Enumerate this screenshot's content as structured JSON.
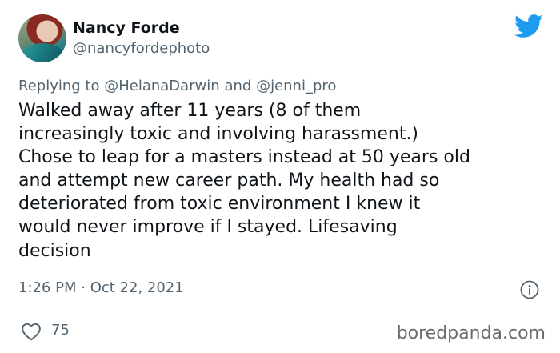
{
  "author": {
    "name": "Nancy Forde",
    "handle": "@nancyfordephoto"
  },
  "reply": {
    "prefix": "Replying to",
    "mention1": "@HelanaDarwin",
    "conjunction": "and",
    "mention2": "@jenni_pro"
  },
  "tweet": {
    "lines": [
      "Walked away after 11 years (8 of them",
      "increasingly toxic and involving harassment.)",
      "Chose to leap for a masters instead at 50 years old",
      "and attempt new career path. My health had so",
      "deteriorated from toxic environment I knew it",
      "would never improve if I stayed. Lifesaving",
      "decision"
    ],
    "timestamp": "1:26 PM · Oct 22, 2021"
  },
  "stats": {
    "likes": "75"
  },
  "watermark": "boredpanda.com",
  "icons": {
    "brand": "twitter-bird-icon",
    "info": "info-icon",
    "like": "heart-icon"
  },
  "colors": {
    "twitter_blue": "#1d9bf0",
    "secondary_text": "#536471",
    "primary_text": "#0f1419"
  }
}
